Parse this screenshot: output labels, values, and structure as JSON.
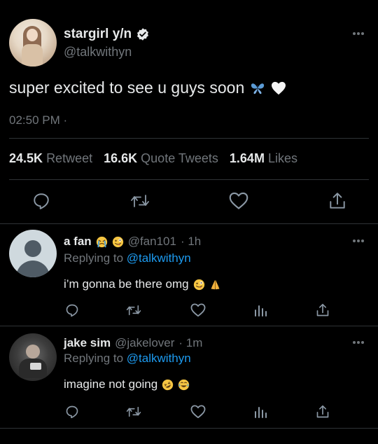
{
  "main_tweet": {
    "display_name": "stargirl y/n",
    "handle": "@talkwithyn",
    "text": "super excited to see u guys soon",
    "time": "02:50 PM",
    "time_suffix": "·",
    "stats": {
      "retweets_count": "24.5K",
      "retweets_label": "Retweet",
      "quotes_count": "16.6K",
      "quotes_label": "Quote Tweets",
      "likes_count": "1.64M",
      "likes_label": "Likes"
    }
  },
  "replies": [
    {
      "name": "a fan",
      "handle": "@fan101",
      "time": "· 1h",
      "replying_prefix": "Replying to",
      "replying_handle": "@talkwithyn",
      "text": "i’m gonna be there omg"
    },
    {
      "name": "jake sim",
      "handle": "@jakelover",
      "time": "· 1m",
      "replying_prefix": "Replying to",
      "replying_handle": "@talkwithyn",
      "text": "imagine not going"
    }
  ],
  "colors": {
    "background": "#000000",
    "text": "#e7e9ea",
    "muted": "#71767b",
    "link": "#1d9bf0",
    "divider": "#2f3336"
  },
  "icons": [
    "verified-badge-icon",
    "more-icon",
    "butterfly-emoji-icon",
    "white-heart-emoji-icon",
    "reply-icon",
    "retweet-icon",
    "like-icon",
    "share-icon",
    "analytics-icon"
  ]
}
